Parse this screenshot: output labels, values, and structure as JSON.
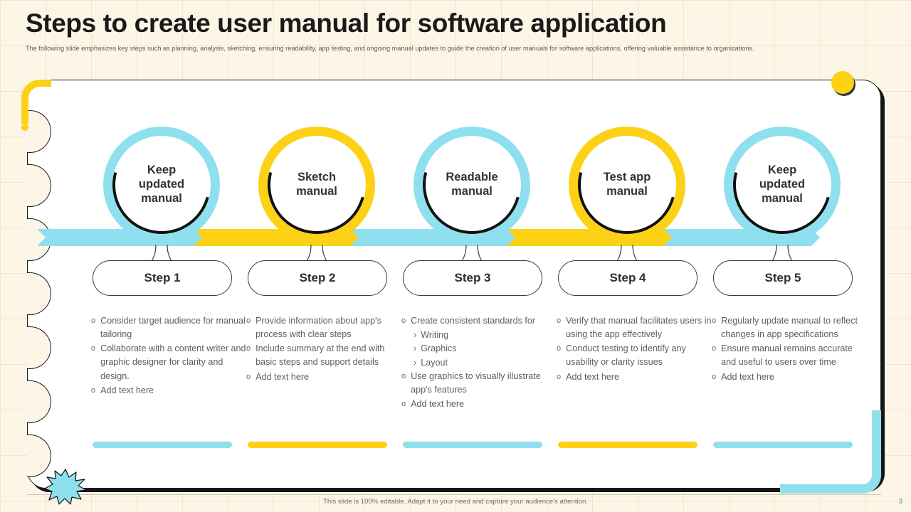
{
  "header": {
    "title": "Steps to create user manual for software application",
    "subtitle": "The following slide emphasizes key steps such as planning, analysis, sketching, ensuring readability, app testing, and ongoing manual updates to guide the creation of user manuals for software applications, offering valuable assistance to organizations."
  },
  "colors": {
    "cyan": "#8fe0ee",
    "yellow": "#fcd116",
    "page_background": "#fdf6e7",
    "card_background": "#ffffff",
    "outline": "#1b1b1b",
    "body_text": "#5e5e5e"
  },
  "steps": [
    {
      "circle_label": "Keep\nupdated\nmanual",
      "circle_color": "cyan",
      "pill_label": "Step 1",
      "accent_color": "cyan",
      "bullets": [
        {
          "text": "Consider target audience for manual tailoring",
          "subs": []
        },
        {
          "text": "Collaborate with a content writer and graphic designer for clarity and design.",
          "subs": []
        },
        {
          "text": "Add text here",
          "subs": []
        }
      ]
    },
    {
      "circle_label": "Sketch\nmanual",
      "circle_color": "yellow",
      "pill_label": "Step 2",
      "accent_color": "yellow",
      "bullets": [
        {
          "text": "Provide information about app's process with clear steps",
          "subs": []
        },
        {
          "text": "Include summary at the end with basic steps and support details",
          "subs": []
        },
        {
          "text": "Add text here",
          "subs": []
        }
      ]
    },
    {
      "circle_label": "Readable\nmanual",
      "circle_color": "cyan",
      "pill_label": "Step 3",
      "accent_color": "cyan",
      "bullets": [
        {
          "text": "Create consistent standards for",
          "subs": [
            "Writing",
            "Graphics",
            "Layout"
          ]
        },
        {
          "text": "Use graphics to visually illustrate app's features",
          "subs": []
        },
        {
          "text": "Add text here",
          "subs": []
        }
      ]
    },
    {
      "circle_label": "Test app\nmanual",
      "circle_color": "yellow",
      "pill_label": "Step 4",
      "accent_color": "yellow",
      "bullets": [
        {
          "text": "Verify that manual facilitates users in using the app effectively",
          "subs": []
        },
        {
          "text": "Conduct testing to identify any usability or clarity issues",
          "subs": []
        },
        {
          "text": "Add text here",
          "subs": []
        }
      ]
    },
    {
      "circle_label": "Keep\nupdated\nmanual",
      "circle_color": "cyan",
      "pill_label": "Step 5",
      "accent_color": "cyan",
      "bullets": [
        {
          "text": "Regularly update manual to reflect changes in app specifications",
          "subs": []
        },
        {
          "text": "Ensure manual remains accurate and useful to users over time",
          "subs": []
        },
        {
          "text": "Add text here",
          "subs": []
        }
      ]
    }
  ],
  "band": {
    "segments": [
      {
        "color": "cyan"
      },
      {
        "color": "yellow"
      },
      {
        "color": "cyan"
      },
      {
        "color": "yellow"
      },
      {
        "color": "cyan"
      }
    ]
  },
  "bullet_marker": "o",
  "sub_marker": "›",
  "footer": {
    "note": "This slide is 100% editable. Adapt it to your need and capture your audience's attention.",
    "page_number": "3"
  }
}
